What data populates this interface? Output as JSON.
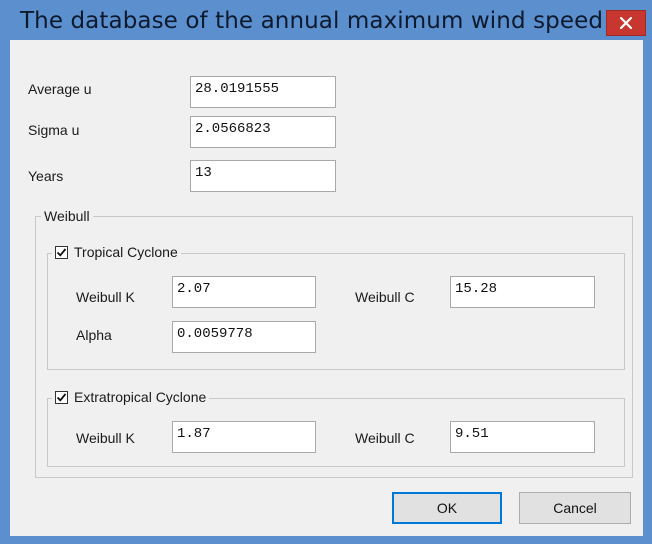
{
  "window": {
    "title": "The database of the annual maximum wind speed -...",
    "close_icon": "close-icon"
  },
  "fields": {
    "average_u": {
      "label": "Average u",
      "value": "28.0191555"
    },
    "sigma_u": {
      "label": "Sigma u",
      "value": "2.0566823"
    },
    "years": {
      "label": "Years",
      "value": "13"
    }
  },
  "weibull": {
    "legend": "Weibull",
    "tropical": {
      "label": "Tropical Cyclone",
      "checked": true,
      "weibull_k_label": "Weibull K",
      "weibull_k": "2.07",
      "weibull_c_label": "Weibull C",
      "weibull_c": "15.28",
      "alpha_label": "Alpha",
      "alpha": "0.0059778"
    },
    "extratropical": {
      "label": "Extratropical Cyclone",
      "checked": true,
      "weibull_k_label": "Weibull K",
      "weibull_k": "1.87",
      "weibull_c_label": "Weibull C",
      "weibull_c": "9.51"
    }
  },
  "buttons": {
    "ok": "OK",
    "cancel": "Cancel"
  },
  "colors": {
    "title_bar": "#5b8fce",
    "close_button": "#c7362f",
    "client_background": "#f0f0f0"
  }
}
